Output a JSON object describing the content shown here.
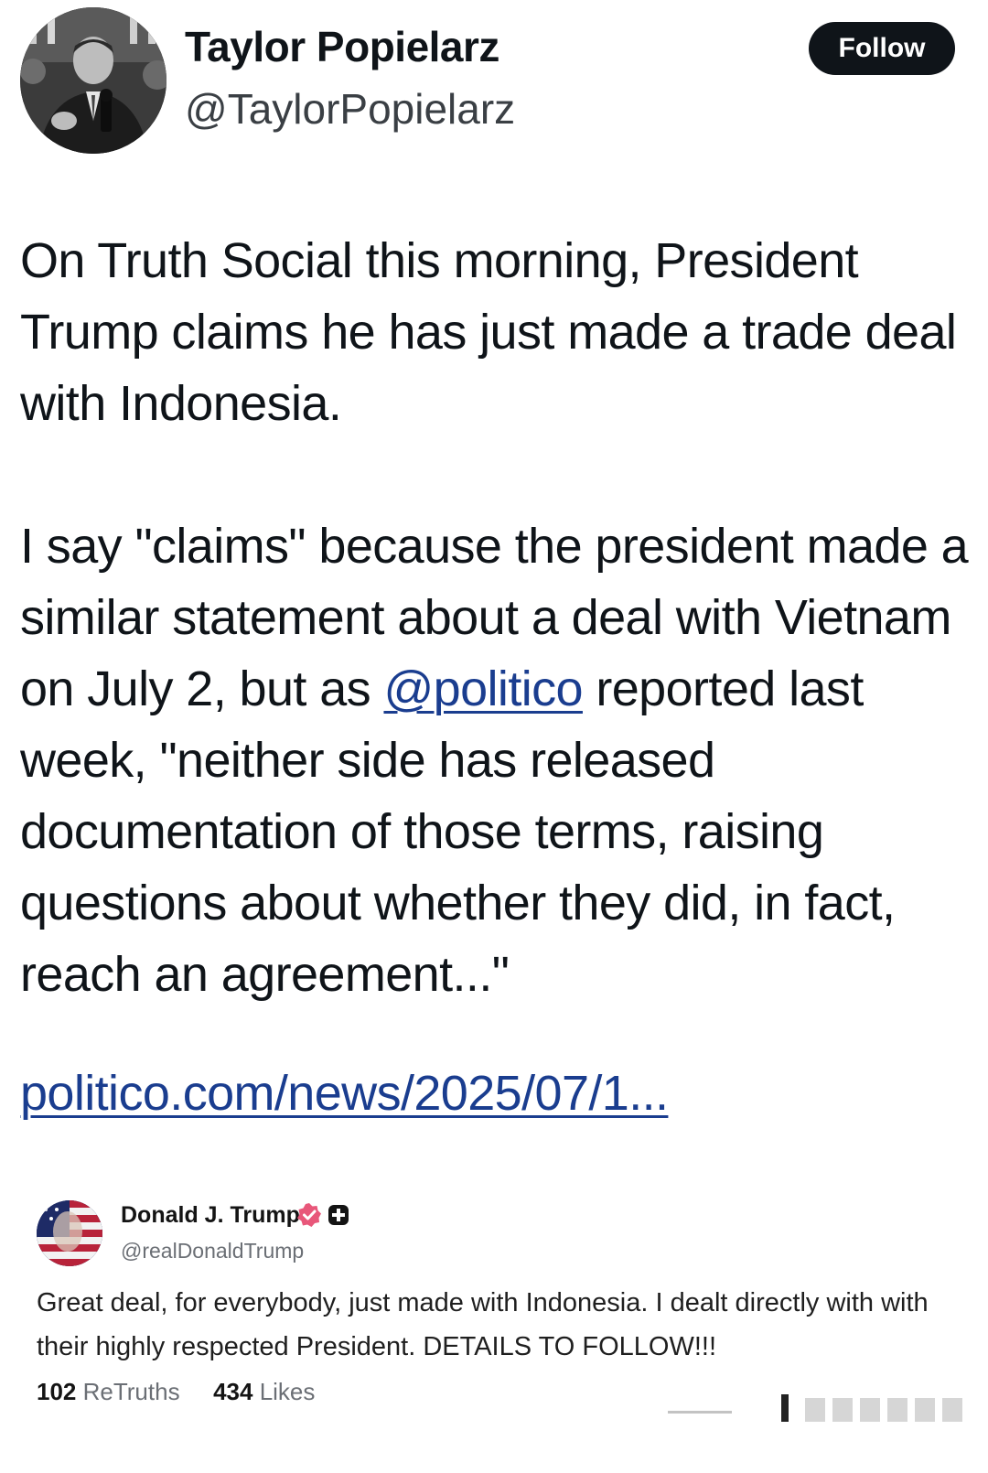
{
  "author": {
    "name": "Taylor Popielarz",
    "handle": "@TaylorPopielarz",
    "avatar_icon": "profile-photo-icon"
  },
  "follow_button": {
    "label": "Follow"
  },
  "tweet": {
    "para1": "On Truth Social this morning, President Trump claims he has just made a trade deal with Indonesia.",
    "para2_before": "I say \"claims\" because the president made a similar statement about a deal with Vietnam on July 2, but as ",
    "mention": "@politico",
    "para2_after": " reported last week, \"neither side has released documentation of those terms, raising questions about whether they did, in fact, reach an agreement...\"",
    "link": "politico.com/news/2025/07/1..."
  },
  "embedded_post": {
    "name": "Donald J. Trump",
    "handle": "@realDonaldTrump",
    "text": "Great deal, for everybody, just made with Indonesia. I dealt directly with with their highly respected President. DETAILS TO FOLLOW!!!",
    "retruths_count": "102",
    "retruths_label": "ReTruths",
    "likes_count": "434",
    "likes_label": "Likes",
    "verified_color": "#e8577a"
  },
  "colors": {
    "text": "#0f1419",
    "link": "#1a3d8f",
    "follow_bg": "#0f1419",
    "muted": "#6b6f75"
  }
}
